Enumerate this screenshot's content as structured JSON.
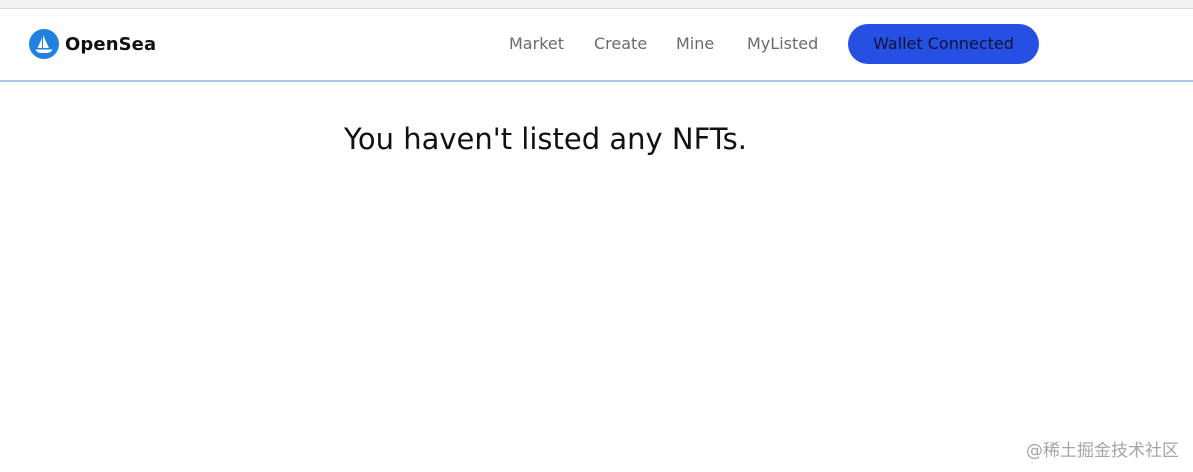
{
  "brand": {
    "name": "OpenSea",
    "logo_icon": "opensea-logo-icon",
    "logo_color": "#2081e2"
  },
  "nav": {
    "links": [
      {
        "label": "Market"
      },
      {
        "label": "Create"
      },
      {
        "label": "Mine"
      },
      {
        "label": "MyListed"
      }
    ],
    "wallet_button_label": "Wallet Connected",
    "wallet_button_color": "#2650e3"
  },
  "main": {
    "empty_message": "You haven't listed any NFTs."
  },
  "watermark": {
    "text": "@稀土掘金技术社区"
  }
}
